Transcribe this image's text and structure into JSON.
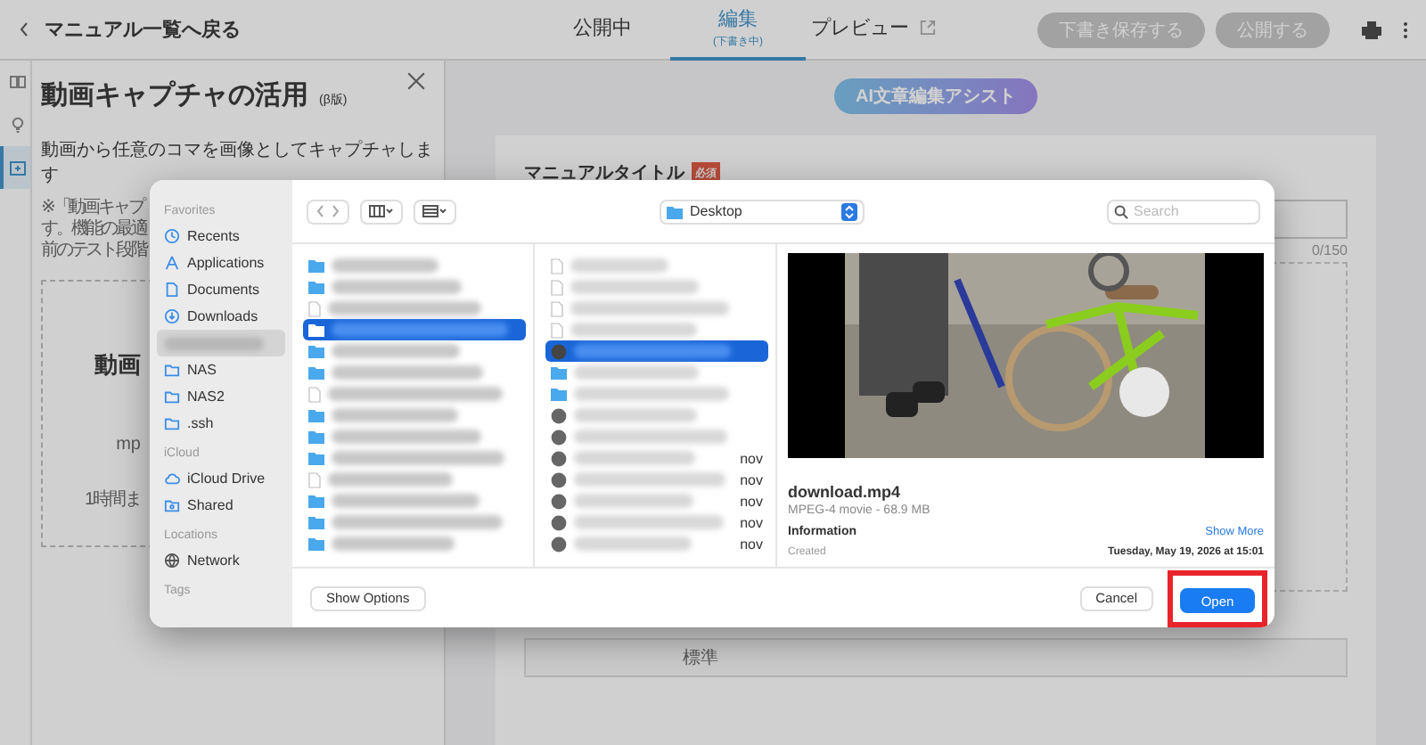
{
  "header": {
    "back": "マニュアル一覧へ戻る",
    "tabs": [
      {
        "label": "公開中",
        "selected": false,
        "external": false
      },
      {
        "label": "編集",
        "note": "(下書き中)",
        "selected": true,
        "external": false
      },
      {
        "label": "プレビュー",
        "selected": false,
        "external": true
      }
    ],
    "buttons": [
      {
        "label": "下書き保存する",
        "disabled": true
      },
      {
        "label": "公開する",
        "disabled": true
      }
    ]
  },
  "rail": [
    {
      "kind": "book",
      "selected": false
    },
    {
      "kind": "idea",
      "selected": false
    },
    {
      "kind": "capture",
      "selected": true
    }
  ],
  "panel": {
    "title": "動画キャプチャの活用",
    "badge": "(β版)",
    "description": "動画から任意のコマを画像としてキャプチャします",
    "note_lines": [
      "※「動画キャプ",
      "す。機能の最適",
      "前のテスト段階"
    ],
    "card": {
      "title": "動画",
      "file": "mp",
      "time": "1時間ま"
    }
  },
  "editor": {
    "ai_button": "AI文章編集アシスト",
    "title_label": "マニュアルタイトル",
    "required": "必須",
    "counter": "0/150",
    "style_select": "標準"
  },
  "dialog": {
    "location": "Desktop",
    "search_placeholder": "Search",
    "sidebar": [
      {
        "heading": "Favorites",
        "items": [
          {
            "kind": "recents",
            "label": "Recents"
          },
          {
            "kind": "apps",
            "label": "Applications"
          },
          {
            "kind": "doc",
            "label": "Documents"
          },
          {
            "kind": "download",
            "label": "Downloads"
          },
          {
            "kind": "redacted"
          },
          {
            "kind": "folder",
            "label": "NAS"
          },
          {
            "kind": "folder",
            "label": "NAS2"
          },
          {
            "kind": "folder",
            "label": ".ssh"
          }
        ]
      },
      {
        "heading": "iCloud",
        "items": [
          {
            "kind": "cloud",
            "label": "iCloud Drive"
          },
          {
            "kind": "shared",
            "label": "Shared"
          }
        ]
      },
      {
        "heading": "Locations",
        "items": [
          {
            "kind": "globe",
            "label": "Network"
          }
        ]
      },
      {
        "heading": "Tags"
      }
    ],
    "column_1": [
      {
        "kind": "folder",
        "selected": false
      },
      {
        "kind": "folder",
        "selected": false
      },
      {
        "kind": "file",
        "selected": false
      },
      {
        "kind": "folder",
        "selected": true
      },
      {
        "kind": "folder",
        "selected": false
      },
      {
        "kind": "folder",
        "selected": false
      },
      {
        "kind": "file",
        "selected": false
      },
      {
        "kind": "folder",
        "selected": false
      },
      {
        "kind": "folder",
        "selected": false
      },
      {
        "kind": "folder",
        "selected": false
      },
      {
        "kind": "file",
        "selected": false
      },
      {
        "kind": "folder",
        "selected": false
      },
      {
        "kind": "folder",
        "selected": false
      },
      {
        "kind": "folder",
        "selected": false
      }
    ],
    "column_2": [
      {
        "kind": "file",
        "selected": false
      },
      {
        "kind": "file",
        "selected": false
      },
      {
        "kind": "file",
        "selected": false
      },
      {
        "kind": "file",
        "selected": false
      },
      {
        "kind": "video",
        "selected": true
      },
      {
        "kind": "folder",
        "selected": false
      },
      {
        "kind": "folder",
        "selected": false
      },
      {
        "kind": "video",
        "selected": false
      },
      {
        "kind": "video",
        "selected": false
      },
      {
        "kind": "video",
        "selected": false,
        "suffix": "nov"
      },
      {
        "kind": "video",
        "selected": false,
        "suffix": "nov"
      },
      {
        "kind": "video",
        "selected": false,
        "suffix": "nov"
      },
      {
        "kind": "video",
        "selected": false,
        "suffix": "nov"
      },
      {
        "kind": "video",
        "selected": false,
        "suffix": "nov"
      }
    ],
    "preview": {
      "kind": "picture",
      "filename": "download.mp4",
      "meta": "MPEG-4 movie - 68.9 MB",
      "info_heading": "Information",
      "show_more": "Show More",
      "created_label": "Created",
      "created_value": "Tuesday, May 19, 2026 at 15:01"
    },
    "show_options": "Show Options",
    "cancel": "Cancel",
    "open": {
      "label": "Open",
      "highlighted": true
    }
  }
}
